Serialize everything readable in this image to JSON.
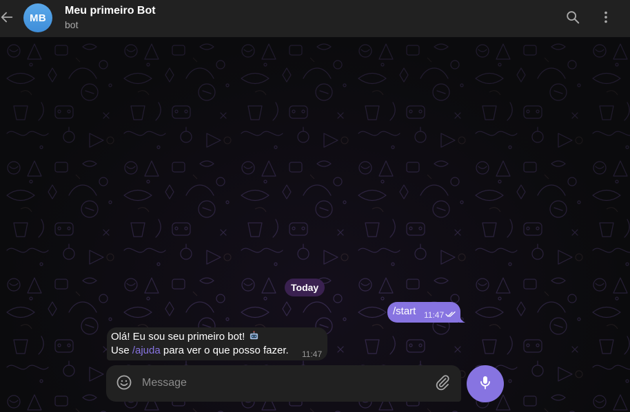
{
  "header": {
    "avatar_initials": "MB",
    "title": "Meu primeiro Bot",
    "subtitle": "bot",
    "back_icon": "arrow-left-icon",
    "search_icon": "search-icon",
    "more_icon": "more-vertical-icon"
  },
  "chat": {
    "date_separator": "Today",
    "messages": [
      {
        "direction": "outgoing",
        "text": "/start",
        "time": "11:47",
        "status": "read"
      },
      {
        "direction": "incoming",
        "line1": "Olá! Eu sou seu primeiro bot!",
        "line1_emoji": "robot-emoji",
        "line2_prefix": "Use ",
        "line2_command": "/ajuda",
        "line2_suffix": " para ver o que posso fazer.",
        "time": "11:47"
      }
    ]
  },
  "composer": {
    "placeholder": "Message",
    "value": "",
    "emoji_icon": "smile-icon",
    "attach_icon": "paperclip-icon",
    "mic_icon": "microphone-icon"
  },
  "colors": {
    "accent": "#8774e1",
    "header_bg": "#212121",
    "bubble_in_bg": "#212121",
    "avatar_bg": "#4f9be2",
    "date_chip_bg": "#3a2150",
    "background": "#0b0b0d"
  }
}
